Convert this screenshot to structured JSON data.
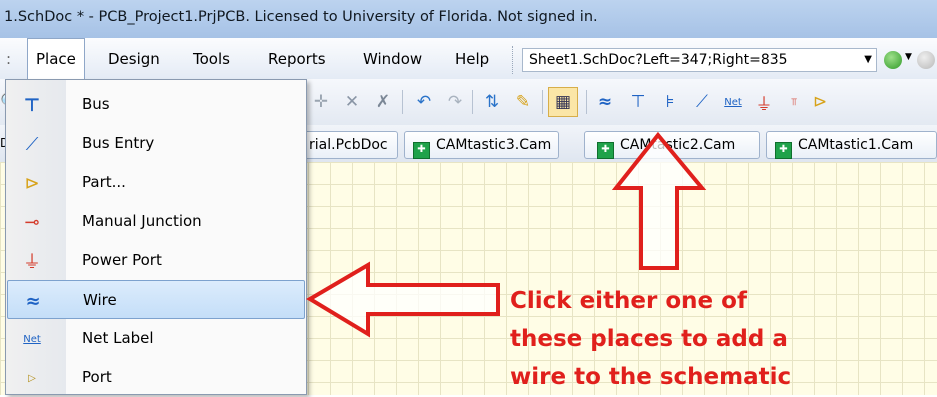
{
  "window": {
    "title": "1.SchDoc * - PCB_Project1.PrjPCB. Licensed to University of Florida. Not signed in."
  },
  "menubar": {
    "items": [
      {
        "label": "Place",
        "open": true
      },
      {
        "label": "Design"
      },
      {
        "label": "Tools"
      },
      {
        "label": "Reports"
      },
      {
        "label": "Window"
      },
      {
        "label": "Help"
      }
    ],
    "path_value": "Sheet1.SchDoc?Left=347;Right=835"
  },
  "tabs": [
    {
      "label": "rial.PcbDoc"
    },
    {
      "label": "CAMtastic3.Cam"
    },
    {
      "label": "CAMtastic2.Cam"
    },
    {
      "label": "CAMtastic1.Cam"
    }
  ],
  "place_menu": {
    "items": [
      {
        "label": "Bus",
        "icon": "bus-icon"
      },
      {
        "label": "Bus Entry",
        "icon": "bus-entry-icon"
      },
      {
        "label": "Part...",
        "icon": "part-icon"
      },
      {
        "label": "Manual Junction",
        "icon": "junction-icon"
      },
      {
        "label": "Power Port",
        "icon": "power-port-icon"
      },
      {
        "label": "Wire",
        "icon": "wire-icon",
        "selected": true
      },
      {
        "label": "Net Label",
        "icon": "net-label-icon"
      },
      {
        "label": "Port",
        "icon": "port-icon"
      }
    ]
  },
  "annotation": {
    "line1": "Click either one of",
    "line2": "these places to add a",
    "line3": "wire to the schematic",
    "color": "#e0201c"
  }
}
